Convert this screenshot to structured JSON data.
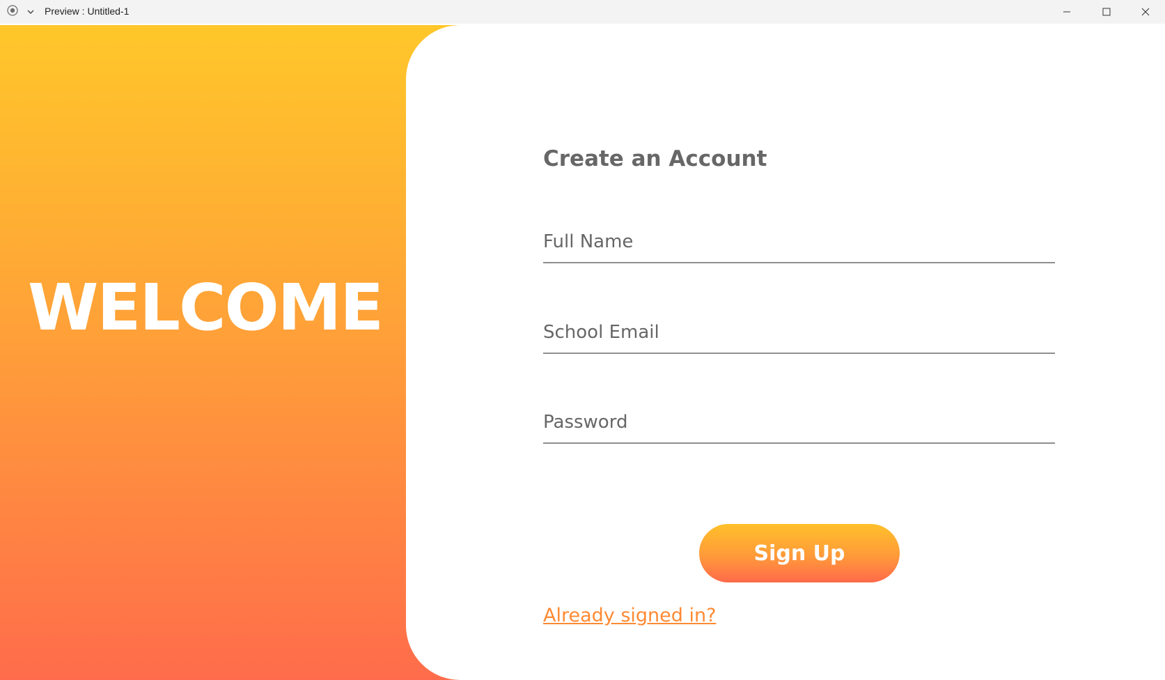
{
  "window": {
    "title": "Preview : Untitled-1",
    "icons": {
      "app": "record-circle-icon",
      "menu": "chevron-down-icon",
      "minimize": "minimize-icon",
      "maximize": "maximize-icon",
      "close": "close-icon"
    }
  },
  "left_panel": {
    "welcome_text": "WELCOME",
    "gradient": [
      "#ffc72a",
      "#ffa238",
      "#ff6c4b"
    ]
  },
  "form": {
    "heading": "Create an Account",
    "full_name": {
      "placeholder": "Full Name",
      "value": ""
    },
    "email": {
      "placeholder": "School Email",
      "value": ""
    },
    "password": {
      "placeholder": "Password",
      "value": ""
    },
    "signup_label": "Sign Up",
    "already_link": "Already signed in?"
  },
  "colors": {
    "heading": "#676767",
    "link": "#ff8a33",
    "underline": "#8f8f8f"
  }
}
